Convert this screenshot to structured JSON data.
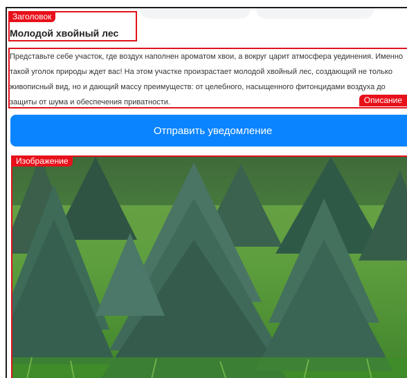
{
  "title_section": {
    "tag": "Заголовок",
    "title": "Молодой хвойный лес"
  },
  "description_section": {
    "tag": "Описание",
    "text": "Представьте себе участок, где воздух наполнен ароматом хвои, а вокруг царит атмосфера уединения. Именно такой уголок природы ждет вас! На этом участке произрастает молодой хвойный лес, создающий не только живописный вид, но и дающий массу преимуществ: от целебного, насыщенного фитонцидами воздуха до защиты от шума и обеспечения приватности."
  },
  "actions": {
    "send_notification_label": "Отправить уведомление"
  },
  "image_section": {
    "tag": "Изображение",
    "image": "young-spruce-forest-photo"
  },
  "colors": {
    "annotation_red": "#e0121b",
    "button_blue": "#0b84ff"
  }
}
